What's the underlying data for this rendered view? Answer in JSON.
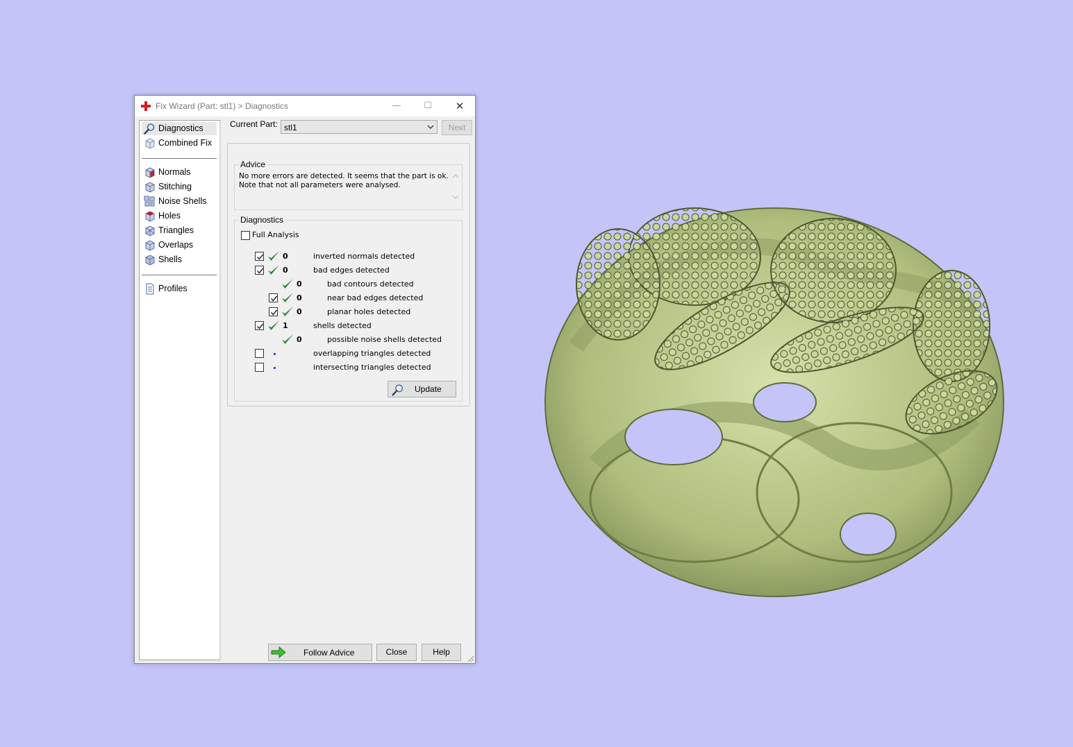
{
  "window": {
    "title": "Fix Wizard (Part: stl1) > Diagnostics",
    "minimize_glyph": "—",
    "maximize_glyph": "☐",
    "close_glyph": "✕"
  },
  "nav": {
    "items": [
      {
        "label": "Diagnostics",
        "icon": "magnifier-icon",
        "selected": true
      },
      {
        "label": "Combined Fix",
        "icon": "cube-icon"
      },
      {
        "label": "Normals",
        "icon": "normals-cube-icon"
      },
      {
        "label": "Stitching",
        "icon": "stitching-cube-icon"
      },
      {
        "label": "Noise Shells",
        "icon": "noise-shells-icon"
      },
      {
        "label": "Holes",
        "icon": "holes-cube-icon"
      },
      {
        "label": "Triangles",
        "icon": "triangles-cube-icon"
      },
      {
        "label": "Overlaps",
        "icon": "overlaps-cube-icon"
      },
      {
        "label": "Shells",
        "icon": "shells-cube-icon"
      },
      {
        "label": "Profiles",
        "icon": "document-icon"
      }
    ]
  },
  "header": {
    "current_part_label": "Current Part:",
    "current_part_value": "stl1",
    "next_label": "Next"
  },
  "advice": {
    "title": "Advice",
    "line1": "No more errors are detected. It seems that the part is ok.",
    "line2": "Note that not all parameters were analysed."
  },
  "diagnostics": {
    "title": "Diagnostics",
    "full_analysis_label": "Full Analysis",
    "full_analysis_checked": false,
    "rows": [
      {
        "count": "0",
        "label": "inverted normals detected",
        "checked": true,
        "status": "ok",
        "indent": 0
      },
      {
        "count": "0",
        "label": "bad edges detected",
        "checked": true,
        "status": "ok",
        "indent": 0
      },
      {
        "count": "0",
        "label": "bad contours detected",
        "checked": null,
        "status": "ok",
        "indent": 1
      },
      {
        "count": "0",
        "label": "near bad edges detected",
        "checked": true,
        "status": "ok",
        "indent": 1
      },
      {
        "count": "0",
        "label": "planar holes detected",
        "checked": true,
        "status": "ok",
        "indent": 1
      },
      {
        "count": "1",
        "label": "shells detected",
        "checked": true,
        "status": "ok",
        "indent": 0
      },
      {
        "count": "0",
        "label": "possible noise shells detected",
        "checked": null,
        "status": "ok",
        "indent": 1
      },
      {
        "count": "",
        "label": "overlapping triangles detected",
        "checked": false,
        "status": "pending",
        "indent": 0
      },
      {
        "count": "",
        "label": "intersecting triangles detected",
        "checked": false,
        "status": "pending",
        "indent": 0
      }
    ],
    "update_label": "Update"
  },
  "footer": {
    "follow_advice_label": "Follow Advice",
    "close_label": "Close",
    "help_label": "Help"
  },
  "colors": {
    "background": "#c4c4f8",
    "model": "#b9c98a",
    "check_green": "#2e8b3a"
  }
}
